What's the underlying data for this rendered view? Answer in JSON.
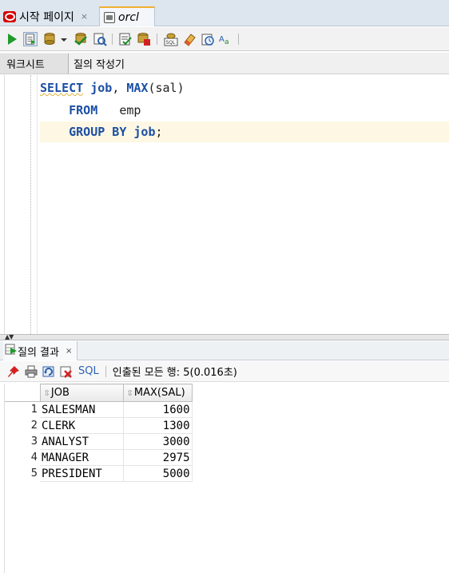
{
  "tabs": {
    "start_page": "시작 페이지",
    "close_glyph": "×",
    "connection": "orcl"
  },
  "toolbar": {
    "icons": [
      "run-statement-icon",
      "run-script-icon",
      "commit-icon",
      "dropdown-icon",
      "rollback-icon",
      "autotrace-icon",
      "explain-plan-icon",
      "tuning-icon",
      "sql-icon",
      "eraser-icon",
      "history-icon",
      "format-icon"
    ]
  },
  "subtabs": {
    "worksheet": "워크시트",
    "query_builder": "질의 작성기"
  },
  "editor": {
    "line1": {
      "select": "SELECT",
      "col": "job",
      "comma": ",",
      "fn": "MAX",
      "arg": "(sal)"
    },
    "line2": {
      "from": "FROM",
      "table": "emp"
    },
    "line3": {
      "group_by": "GROUP BY",
      "col": "job",
      "semicolon": ";"
    }
  },
  "results": {
    "tab_label": "질의 결과",
    "close_glyph": "×",
    "sql_label": "SQL",
    "status": "인출된 모든 행: 5(0.016초)",
    "columns": [
      "JOB",
      "MAX(SAL)"
    ],
    "rows": [
      {
        "n": "1",
        "job": "SALESMAN",
        "max": "1600"
      },
      {
        "n": "2",
        "job": "CLERK",
        "max": "1300"
      },
      {
        "n": "3",
        "job": "ANALYST",
        "max": "3000"
      },
      {
        "n": "4",
        "job": "MANAGER",
        "max": "2975"
      },
      {
        "n": "5",
        "job": "PRESIDENT",
        "max": "5000"
      }
    ]
  },
  "colors": {
    "keyword": "#1c4fa4",
    "current_line": "#fdf7e3",
    "tab_accent": "#f0b030"
  }
}
